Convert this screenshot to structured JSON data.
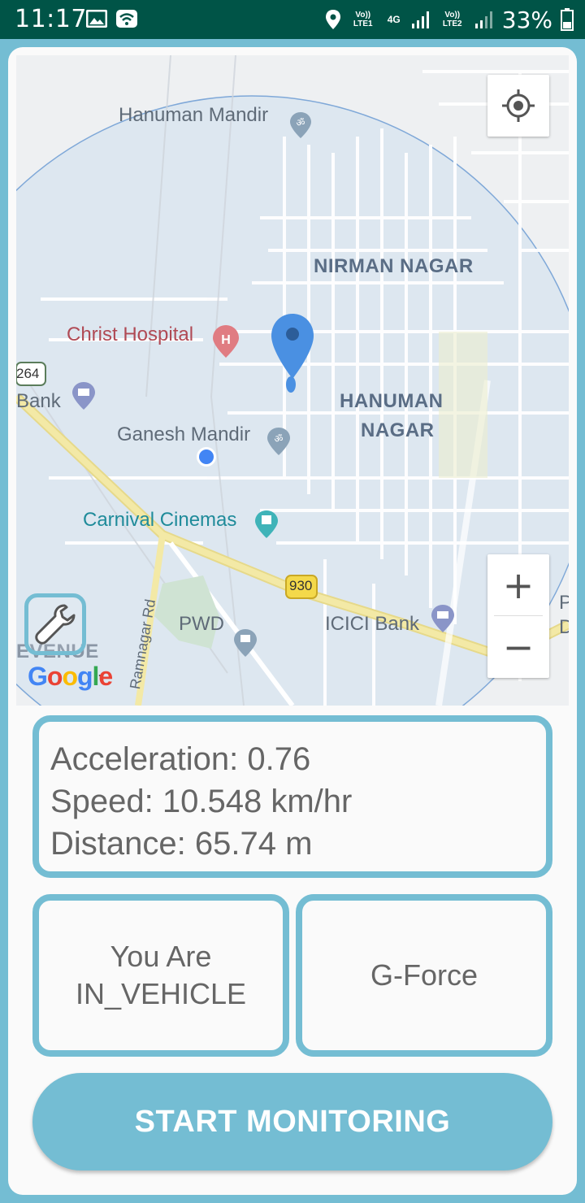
{
  "status_bar": {
    "time": "11:17",
    "sim1_label": "Vo)) LTE1",
    "network_type": "4G",
    "sim2_label": "Vo)) LTE2",
    "battery_percent": "33%"
  },
  "map": {
    "labels": {
      "hanuman_mandir": "Hanuman Mandir",
      "nirman_nagar": "NIRMAN NAGAR",
      "christ_hospital": "Christ Hospital",
      "hanuman_nagar_1": "HANUMAN",
      "hanuman_nagar_2": "NAGAR",
      "bank": "Bank",
      "ganesh_mandir": "Ganesh Mandir",
      "carnival_cinemas": "Carnival Cinemas",
      "road_930": "930",
      "road_264": "264",
      "ramnagar_rd": "Ramnagar Rd",
      "pwd": "PWD",
      "icici_bank": "ICICI Bank",
      "avenue": "EVENUE",
      "edge_p": "P",
      "edge_d": "D"
    },
    "zoom_in_label": "+",
    "zoom_out_label": "−",
    "attribution": "Google",
    "colors": {
      "area": "#dde7f0",
      "road": "#ffffff",
      "highway": "#f3e9a6",
      "pin": "#4a90e2",
      "location_dot": "#4285f4"
    }
  },
  "stats": {
    "acceleration": "Acceleration: 0.76",
    "speed": "Speed: 10.548 km/hr",
    "distance": "Distance: 65.74 m"
  },
  "activity": {
    "line1": "You Are",
    "line2": "IN_VEHICLE"
  },
  "gforce": {
    "label": "G-Force"
  },
  "start_button": {
    "label": "START MONITORING"
  },
  "theme": {
    "accent": "#74bdd3",
    "status_bar": "#005447"
  }
}
